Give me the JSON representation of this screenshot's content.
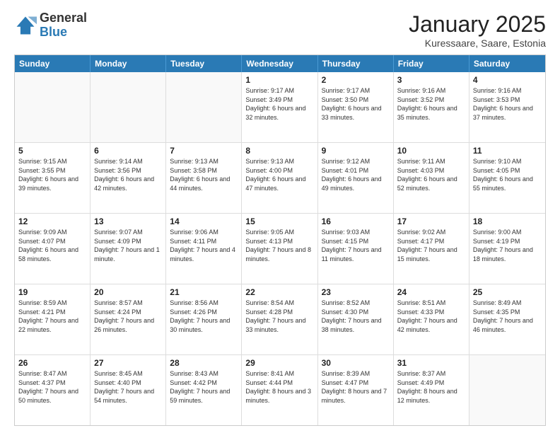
{
  "logo": {
    "general": "General",
    "blue": "Blue"
  },
  "header": {
    "title": "January 2025",
    "subtitle": "Kuressaare, Saare, Estonia"
  },
  "weekdays": [
    "Sunday",
    "Monday",
    "Tuesday",
    "Wednesday",
    "Thursday",
    "Friday",
    "Saturday"
  ],
  "weeks": [
    [
      {
        "day": "",
        "info": ""
      },
      {
        "day": "",
        "info": ""
      },
      {
        "day": "",
        "info": ""
      },
      {
        "day": "1",
        "info": "Sunrise: 9:17 AM\nSunset: 3:49 PM\nDaylight: 6 hours and 32 minutes."
      },
      {
        "day": "2",
        "info": "Sunrise: 9:17 AM\nSunset: 3:50 PM\nDaylight: 6 hours and 33 minutes."
      },
      {
        "day": "3",
        "info": "Sunrise: 9:16 AM\nSunset: 3:52 PM\nDaylight: 6 hours and 35 minutes."
      },
      {
        "day": "4",
        "info": "Sunrise: 9:16 AM\nSunset: 3:53 PM\nDaylight: 6 hours and 37 minutes."
      }
    ],
    [
      {
        "day": "5",
        "info": "Sunrise: 9:15 AM\nSunset: 3:55 PM\nDaylight: 6 hours and 39 minutes."
      },
      {
        "day": "6",
        "info": "Sunrise: 9:14 AM\nSunset: 3:56 PM\nDaylight: 6 hours and 42 minutes."
      },
      {
        "day": "7",
        "info": "Sunrise: 9:13 AM\nSunset: 3:58 PM\nDaylight: 6 hours and 44 minutes."
      },
      {
        "day": "8",
        "info": "Sunrise: 9:13 AM\nSunset: 4:00 PM\nDaylight: 6 hours and 47 minutes."
      },
      {
        "day": "9",
        "info": "Sunrise: 9:12 AM\nSunset: 4:01 PM\nDaylight: 6 hours and 49 minutes."
      },
      {
        "day": "10",
        "info": "Sunrise: 9:11 AM\nSunset: 4:03 PM\nDaylight: 6 hours and 52 minutes."
      },
      {
        "day": "11",
        "info": "Sunrise: 9:10 AM\nSunset: 4:05 PM\nDaylight: 6 hours and 55 minutes."
      }
    ],
    [
      {
        "day": "12",
        "info": "Sunrise: 9:09 AM\nSunset: 4:07 PM\nDaylight: 6 hours and 58 minutes."
      },
      {
        "day": "13",
        "info": "Sunrise: 9:07 AM\nSunset: 4:09 PM\nDaylight: 7 hours and 1 minute."
      },
      {
        "day": "14",
        "info": "Sunrise: 9:06 AM\nSunset: 4:11 PM\nDaylight: 7 hours and 4 minutes."
      },
      {
        "day": "15",
        "info": "Sunrise: 9:05 AM\nSunset: 4:13 PM\nDaylight: 7 hours and 8 minutes."
      },
      {
        "day": "16",
        "info": "Sunrise: 9:03 AM\nSunset: 4:15 PM\nDaylight: 7 hours and 11 minutes."
      },
      {
        "day": "17",
        "info": "Sunrise: 9:02 AM\nSunset: 4:17 PM\nDaylight: 7 hours and 15 minutes."
      },
      {
        "day": "18",
        "info": "Sunrise: 9:00 AM\nSunset: 4:19 PM\nDaylight: 7 hours and 18 minutes."
      }
    ],
    [
      {
        "day": "19",
        "info": "Sunrise: 8:59 AM\nSunset: 4:21 PM\nDaylight: 7 hours and 22 minutes."
      },
      {
        "day": "20",
        "info": "Sunrise: 8:57 AM\nSunset: 4:24 PM\nDaylight: 7 hours and 26 minutes."
      },
      {
        "day": "21",
        "info": "Sunrise: 8:56 AM\nSunset: 4:26 PM\nDaylight: 7 hours and 30 minutes."
      },
      {
        "day": "22",
        "info": "Sunrise: 8:54 AM\nSunset: 4:28 PM\nDaylight: 7 hours and 33 minutes."
      },
      {
        "day": "23",
        "info": "Sunrise: 8:52 AM\nSunset: 4:30 PM\nDaylight: 7 hours and 38 minutes."
      },
      {
        "day": "24",
        "info": "Sunrise: 8:51 AM\nSunset: 4:33 PM\nDaylight: 7 hours and 42 minutes."
      },
      {
        "day": "25",
        "info": "Sunrise: 8:49 AM\nSunset: 4:35 PM\nDaylight: 7 hours and 46 minutes."
      }
    ],
    [
      {
        "day": "26",
        "info": "Sunrise: 8:47 AM\nSunset: 4:37 PM\nDaylight: 7 hours and 50 minutes."
      },
      {
        "day": "27",
        "info": "Sunrise: 8:45 AM\nSunset: 4:40 PM\nDaylight: 7 hours and 54 minutes."
      },
      {
        "day": "28",
        "info": "Sunrise: 8:43 AM\nSunset: 4:42 PM\nDaylight: 7 hours and 59 minutes."
      },
      {
        "day": "29",
        "info": "Sunrise: 8:41 AM\nSunset: 4:44 PM\nDaylight: 8 hours and 3 minutes."
      },
      {
        "day": "30",
        "info": "Sunrise: 8:39 AM\nSunset: 4:47 PM\nDaylight: 8 hours and 7 minutes."
      },
      {
        "day": "31",
        "info": "Sunrise: 8:37 AM\nSunset: 4:49 PM\nDaylight: 8 hours and 12 minutes."
      },
      {
        "day": "",
        "info": ""
      }
    ]
  ]
}
